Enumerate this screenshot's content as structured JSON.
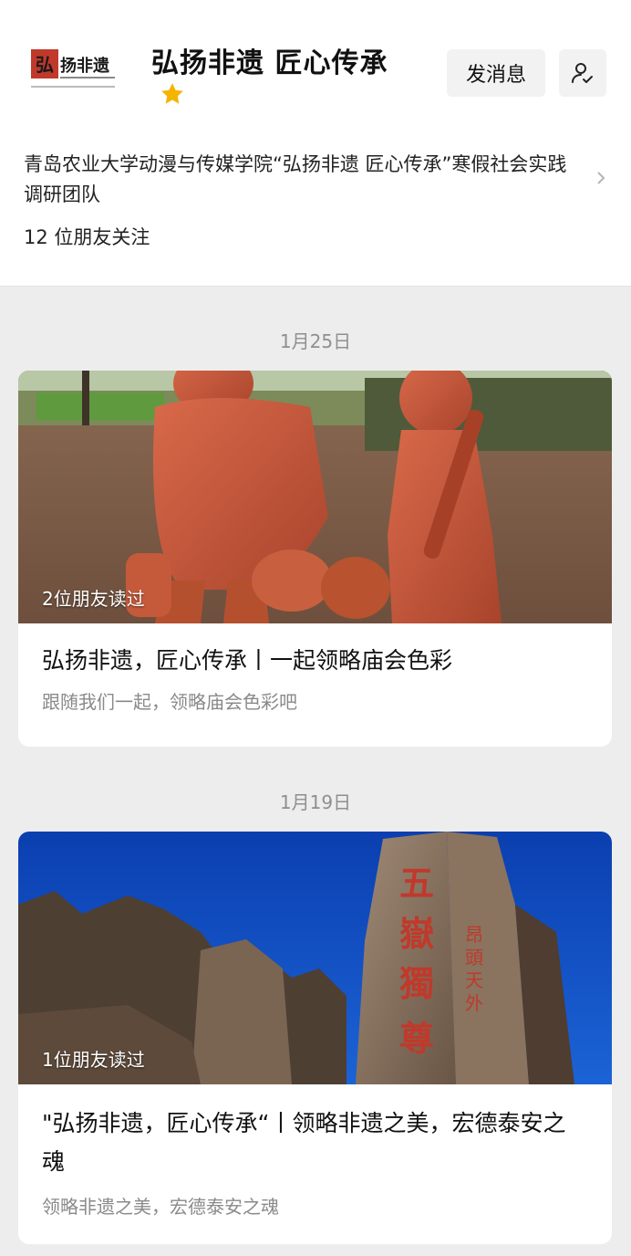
{
  "account": {
    "logo_text": "弘扬非遗",
    "name": "弘扬非遗 匠心传承",
    "star_icon": "star-icon",
    "message_button": "发消息",
    "profile_icon": "user-check-icon",
    "description": "青岛农业大学动漫与传媒学院“弘扬非遗 匠心传承”寒假社会实践调研团队",
    "followers": "12 位朋友关注"
  },
  "articles": [
    {
      "date": "1月25日",
      "read_badge": "2位朋友读过",
      "title": "弘扬非遗，匠心传承丨一起领略庙会色彩",
      "subtitle": "跟随我们一起，领略庙会色彩吧"
    },
    {
      "date": "1月19日",
      "read_badge": "1位朋友读过",
      "title": "\"弘扬非遗，匠心传承“丨领略非遗之美，宏德泰安之魂",
      "subtitle": "领略非遗之美，宏德泰安之魂"
    }
  ],
  "colors": {
    "accent_red": "#c0392b",
    "star": "#f5b400",
    "background": "#ededed"
  }
}
